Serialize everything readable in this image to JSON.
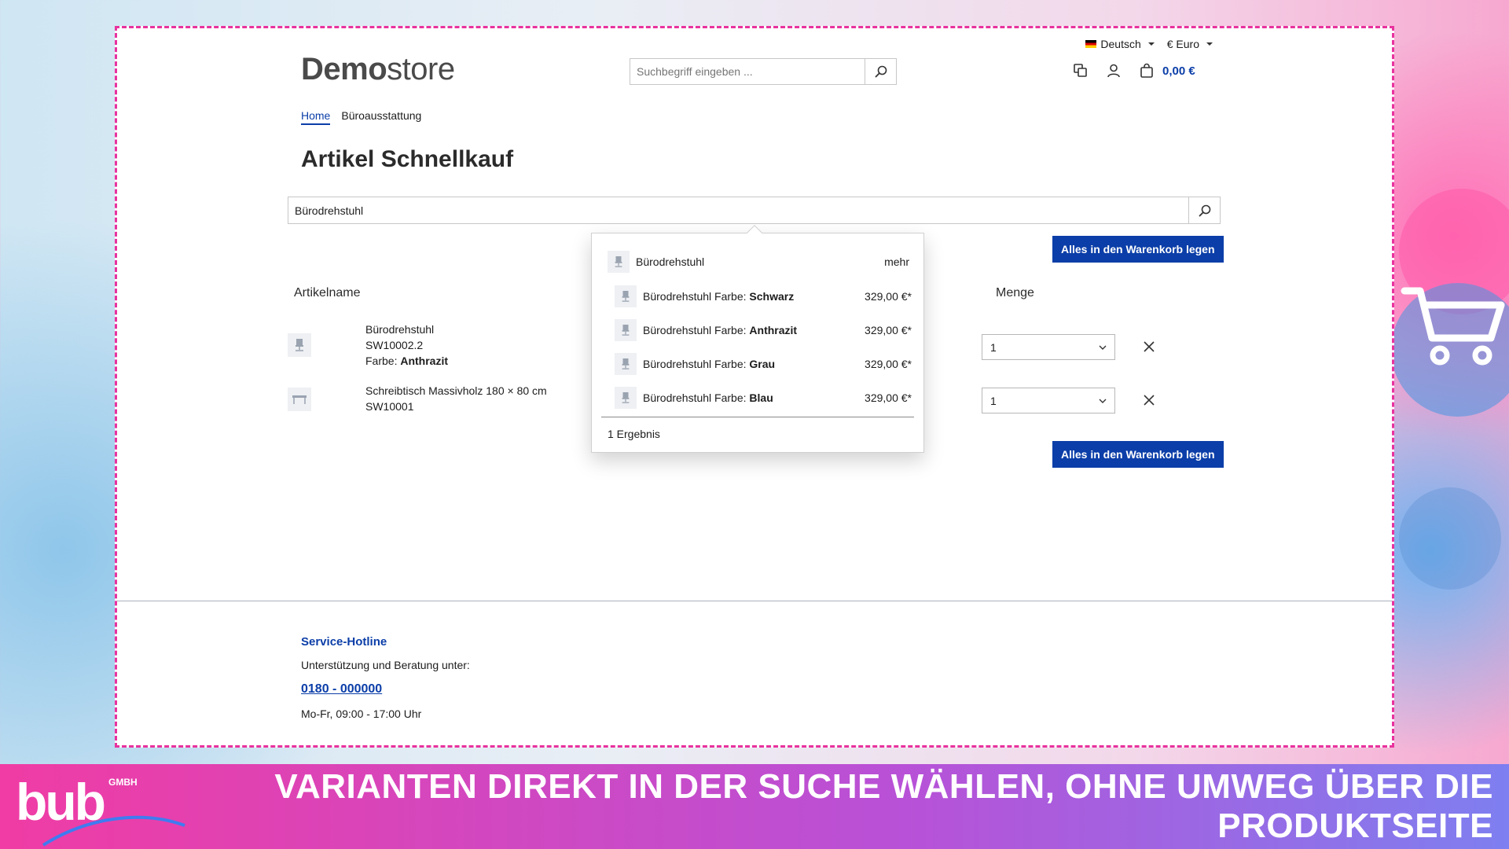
{
  "header": {
    "language": "Deutsch",
    "currency": "€ Euro",
    "logo_bold": "Demo",
    "logo_light": "store",
    "search_placeholder": "Suchbegriff eingeben ...",
    "cart_total": "0,00 €"
  },
  "breadcrumb": {
    "home": "Home",
    "current": "Büroausstattung"
  },
  "page": {
    "title": "Artikel Schnellkauf",
    "search_value": "Bürodrehstuhl",
    "add_all_button": "Alles in den Warenkorb legen",
    "col_article": "Artikelname",
    "col_qty": "Menge"
  },
  "rows": [
    {
      "name": "Bürodrehstuhl",
      "sku": "SW10002.2",
      "attr_label": "Farbe: ",
      "attr_value": "Anthrazit",
      "qty": "1"
    },
    {
      "name": "Schreibtisch Massivholz 180 × 80 cm",
      "sku": "SW10001",
      "qty": "1"
    }
  ],
  "dropdown": {
    "parent": "Bürodrehstuhl",
    "more": "mehr",
    "variants": [
      {
        "label": "Bürodrehstuhl Farbe: ",
        "value": "Schwarz",
        "price": "329,00 €*"
      },
      {
        "label": "Bürodrehstuhl Farbe: ",
        "value": "Anthrazit",
        "price": "329,00 €*"
      },
      {
        "label": "Bürodrehstuhl Farbe: ",
        "value": "Grau",
        "price": "329,00 €*"
      },
      {
        "label": "Bürodrehstuhl Farbe: ",
        "value": "Blau",
        "price": "329,00 €*"
      }
    ],
    "result_count": "1 Ergebnis"
  },
  "footer": {
    "title": "Service-Hotline",
    "subtitle": "Unterstützung und Beratung unter:",
    "phone": "0180 - 000000",
    "hours": "Mo-Fr, 09:00 - 17:00 Uhr"
  },
  "banner": {
    "logo_text": "bub",
    "logo_suffix": "GMBH",
    "headline": "VARIANTEN DIREKT IN DER SUCHE WÄHLEN, OHNE UMWEG ÜBER DIE PRODUKTSEITE"
  },
  "colors": {
    "accent": "#0b3ea8",
    "frame": "#e8329e"
  }
}
